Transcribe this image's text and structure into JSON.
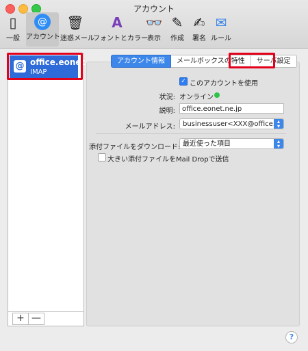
{
  "window": {
    "title": "アカウント"
  },
  "toolbar": [
    {
      "label": "一般",
      "icon": "switch-icon",
      "glyph": "▯"
    },
    {
      "label": "アカウント",
      "icon": "at-icon",
      "glyph": "@"
    },
    {
      "label": "迷惑メール",
      "icon": "junk-trash-icon",
      "glyph": "🗑"
    },
    {
      "label": "フォントとカラー",
      "icon": "font-color-icon",
      "glyph": "A"
    },
    {
      "label": "表示",
      "icon": "glasses-icon",
      "glyph": "👓"
    },
    {
      "label": "作成",
      "icon": "compose-icon",
      "glyph": "✎"
    },
    {
      "label": "署名",
      "icon": "signature-icon",
      "glyph": "✍"
    },
    {
      "label": "ルール",
      "icon": "rules-icon",
      "glyph": "✉"
    }
  ],
  "sidebar": {
    "account_icon": "@",
    "account_name": "office.eonet..",
    "account_type": "IMAP",
    "add_label": "+",
    "remove_label": "—"
  },
  "tabs": [
    {
      "label": "アカウント情報",
      "selected": true
    },
    {
      "label": "メールボックスの特性",
      "selected": false
    },
    {
      "label": "サーバ設定",
      "selected": false
    }
  ],
  "form": {
    "enable_label": "このアカウントを使用",
    "status_label": "状況:",
    "status_value": "オンライン",
    "description_label": "説明:",
    "description_value": "office.eonet.ne.jp",
    "email_label": "メールアドレス:",
    "email_value": "businessuser<XXX@office.eon",
    "download_label": "添付ファイルをダウンロード:",
    "download_value": "最近使った項目",
    "maildrop_label": "大きい添付ファイルをMail Dropで送信"
  },
  "help": {
    "label": "?"
  },
  "colors": {
    "accent": "#3d87ea",
    "highlight": "#e3001b",
    "online": "#2ec44a"
  }
}
